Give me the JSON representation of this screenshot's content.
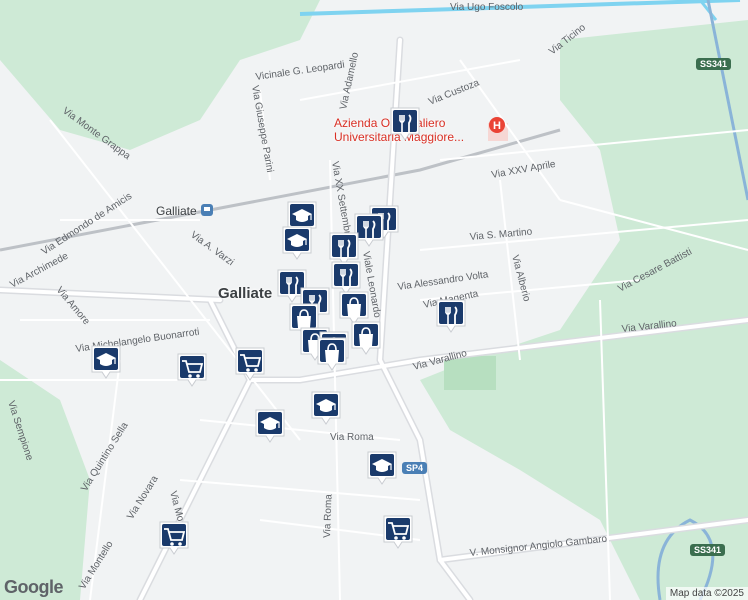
{
  "map": {
    "town_label": "Galliate",
    "hospital_label_line1": "Azienda Ospedaliero",
    "hospital_label_line2": "Universitaria Maggiore...",
    "station_label": "Galliate",
    "attribution": "Map data ©2025",
    "logo": "Google",
    "colors": {
      "background": "#f1f3f4",
      "green": "#ceead6",
      "water": "#7fd3f0",
      "road": "#ffffff",
      "major_road": "#dadce0",
      "highway": "#8ab4d8",
      "marker": "#1a3a6b"
    },
    "road_shields": [
      {
        "label": "SS341"
      },
      {
        "label": "SS341"
      },
      {
        "label": "SP4"
      }
    ],
    "streets": [
      "Via Ugo Foscolo",
      "Via Ticino",
      "Vicinale G. Leopardi",
      "Via Adamello",
      "Via Custoza",
      "Via Monte Grappa",
      "Via Giuseppe Parini",
      "Via XX Settembre",
      "Via XXV Aprile",
      "Via Edmondo de Amicis",
      "Via Archimede",
      "Via A. Varzi",
      "Via S. Martino",
      "Via Cesare Battisti",
      "Via Alessandro Volta",
      "Viale Leonardo",
      "Via Alberio",
      "Via Amore",
      "Via Michelangelo Buonarroti",
      "Via Magenta",
      "Via Varallino",
      "Via Varallino",
      "Via Sempione",
      "Via Quintino Sella",
      "Via Novara",
      "Via Roma",
      "Via Roma",
      "Via Montello",
      "V. Monsignor Angiolo Gambaro",
      "Via Mo"
    ],
    "markers": [
      {
        "type": "restaurant",
        "icon": "cutlery-icon"
      },
      {
        "type": "school",
        "icon": "graduation-cap-icon"
      },
      {
        "type": "restaurant",
        "icon": "cutlery-icon"
      },
      {
        "type": "school",
        "icon": "graduation-cap-icon"
      },
      {
        "type": "restaurant",
        "icon": "cutlery-icon"
      },
      {
        "type": "restaurant",
        "icon": "cutlery-icon"
      },
      {
        "type": "restaurant",
        "icon": "cutlery-icon"
      },
      {
        "type": "restaurant",
        "icon": "cutlery-icon"
      },
      {
        "type": "store",
        "icon": "shopping-bag-icon"
      },
      {
        "type": "restaurant",
        "icon": "cutlery-icon"
      },
      {
        "type": "store",
        "icon": "shopping-bag-icon"
      },
      {
        "type": "store",
        "icon": "shopping-bag-icon"
      },
      {
        "type": "store",
        "icon": "shopping-bag-icon"
      },
      {
        "type": "store",
        "icon": "shopping-bag-icon"
      },
      {
        "type": "store",
        "icon": "shopping-bag-icon"
      },
      {
        "type": "restaurant",
        "icon": "cutlery-icon"
      },
      {
        "type": "school",
        "icon": "graduation-cap-icon"
      },
      {
        "type": "supermarket",
        "icon": "shopping-cart-icon"
      },
      {
        "type": "supermarket",
        "icon": "shopping-cart-icon"
      },
      {
        "type": "school",
        "icon": "graduation-cap-icon"
      },
      {
        "type": "school",
        "icon": "graduation-cap-icon"
      },
      {
        "type": "school",
        "icon": "graduation-cap-icon"
      },
      {
        "type": "supermarket",
        "icon": "shopping-cart-icon"
      },
      {
        "type": "supermarket",
        "icon": "shopping-cart-icon"
      }
    ]
  }
}
